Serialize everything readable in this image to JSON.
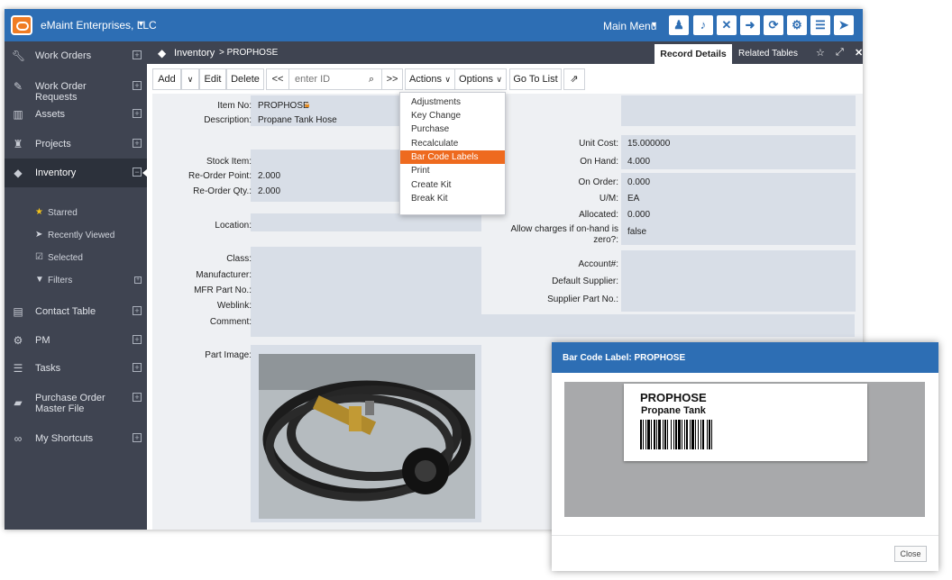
{
  "app": {
    "company": "eMaint Enterprises, LLC",
    "main_menu": "Main Menu"
  },
  "topbar_icons": [
    "user-icon",
    "microphone-icon",
    "close-icon",
    "logout-icon",
    "refresh-icon",
    "gear-icon",
    "menu-icon",
    "navigate-icon"
  ],
  "sidebar": {
    "items": [
      {
        "label": "Work Orders",
        "icon": "wrench-icon"
      },
      {
        "label": "Work Order Requests",
        "icon": "pencil-icon"
      },
      {
        "label": "Assets",
        "icon": "barcode-icon"
      },
      {
        "label": "Projects",
        "icon": "trophy-icon"
      },
      {
        "label": "Inventory",
        "icon": "tag-icon"
      },
      {
        "label": "Contact Table",
        "icon": "book-icon"
      },
      {
        "label": "PM",
        "icon": "gears-icon"
      },
      {
        "label": "Tasks",
        "icon": "tasks-icon"
      },
      {
        "label": "Purchase Order Master File",
        "icon": "truck-icon"
      },
      {
        "label": "My Shortcuts",
        "icon": "link-icon"
      }
    ],
    "sub_items": [
      {
        "label": "Starred",
        "icon": "star-icon"
      },
      {
        "label": "Recently Viewed",
        "icon": "arrow-icon"
      },
      {
        "label": "Selected",
        "icon": "checkbox-icon"
      },
      {
        "label": "Filters",
        "icon": "filter-icon"
      }
    ]
  },
  "breadcrumb": {
    "section": "Inventory",
    "record": "> PROPHOSE"
  },
  "tabs": {
    "record_details": "Record Details",
    "related_tables": "Related Tables"
  },
  "toolbar": {
    "add": "Add",
    "edit": "Edit",
    "delete": "Delete",
    "prev": "<<",
    "next": ">>",
    "id_placeholder": "enter ID",
    "actions": "Actions",
    "options": "Options",
    "go_to_list": "Go To List"
  },
  "actions_menu": [
    "Adjustments",
    "Key Change",
    "Purchase",
    "Recalculate",
    "Bar Code Labels",
    "Print",
    "Create Kit",
    "Break Kit"
  ],
  "form": {
    "item_no_label": "Item No:",
    "item_no": "PROPHOSE",
    "description_label": "Description:",
    "description": "Propane Tank Hose",
    "stock_item_label": "Stock Item:",
    "reorder_point_label": "Re-Order Point:",
    "reorder_point": "2.000",
    "reorder_qty_label": "Re-Order Qty.:",
    "reorder_qty": "2.000",
    "location_label": "Location:",
    "unit_cost_label": "Unit Cost:",
    "unit_cost": "15.000000",
    "on_hand_label": "On Hand:",
    "on_hand": "4.000",
    "on_order_label": "On Order:",
    "on_order": "0.000",
    "um_label": "U/M:",
    "um": "EA",
    "allocated_label": "Allocated:",
    "allocated": "0.000",
    "allow_charges_label_1": "Allow charges if on-hand is",
    "allow_charges_label_2": "zero?:",
    "allow_charges": "false",
    "class_label": "Class:",
    "manufacturer_label": "Manufacturer:",
    "mfr_part_label": "MFR Part No.:",
    "weblink_label": "Weblink:",
    "comment_label": "Comment:",
    "account_label": "Account#:",
    "default_supplier_label": "Default Supplier:",
    "supplier_part_label": "Supplier Part No.:",
    "part_image_label": "Part Image:"
  },
  "modal": {
    "title": "Bar Code Label: PROPHOSE",
    "label_id": "PROPHOSE",
    "label_desc": "Propane Tank",
    "close": "Close"
  },
  "colors": {
    "topbar": "#2d6eb4",
    "sidebar": "#3f4451",
    "highlight": "#ee6a1f",
    "field": "#d8dee7"
  }
}
